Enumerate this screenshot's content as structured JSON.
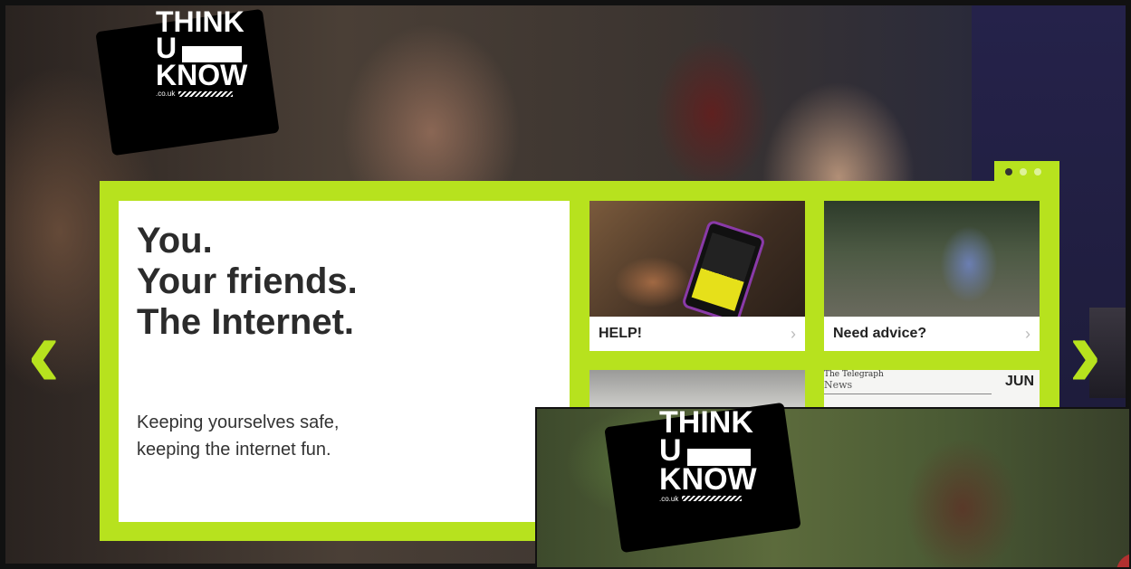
{
  "brand": {
    "line1": "THINK",
    "line2": "U",
    "line3": "KNOW",
    "domain": ".co.uk"
  },
  "hero": {
    "headline": [
      "You.",
      "Your friends.",
      "The Internet."
    ],
    "tagline": [
      "Keeping yourselves safe,",
      "keeping the internet fun."
    ]
  },
  "carousel": {
    "page_count": 3,
    "active_index": 0,
    "prev_icon": "chevron-left-icon",
    "next_icon": "chevron-right-icon"
  },
  "tiles": [
    {
      "label": "HELP!",
      "chevron": "›"
    },
    {
      "label": "Need advice?",
      "chevron": "›"
    }
  ],
  "news_tile": {
    "masthead": "The Telegraph",
    "section": "News",
    "month": "JUN"
  },
  "colors": {
    "accent": "#b7e21e",
    "text": "#2b2b2b"
  }
}
